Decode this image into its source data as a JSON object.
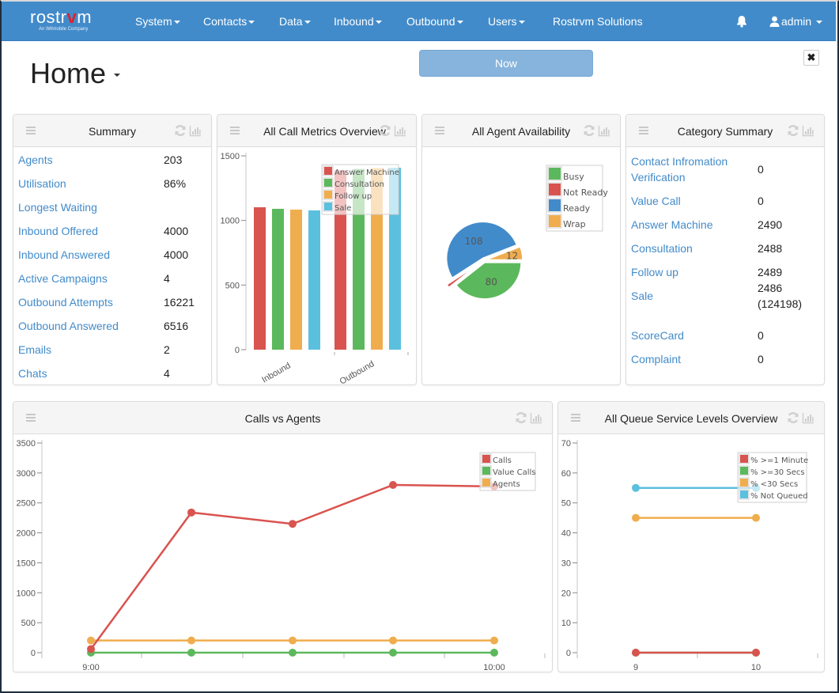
{
  "navbar": {
    "logo": {
      "text_pre": "rostr",
      "text_v": "v",
      "text_post": "m",
      "tagline": "An IMImobile Company"
    },
    "items": [
      {
        "label": "System",
        "dropdown": true
      },
      {
        "label": "Contacts",
        "dropdown": true
      },
      {
        "label": "Data",
        "dropdown": true
      },
      {
        "label": "Inbound",
        "dropdown": true
      },
      {
        "label": "Outbound",
        "dropdown": true
      },
      {
        "label": "Users",
        "dropdown": true
      },
      {
        "label": "Rostrvm Solutions",
        "dropdown": false
      }
    ],
    "notifications_icon": "bell-icon",
    "user": {
      "label": "admin",
      "icon": "user-icon"
    }
  },
  "page": {
    "title": "Home",
    "now_button": "Now",
    "close_button": "✖"
  },
  "panels": {
    "summary": {
      "title": "Summary",
      "rows": [
        {
          "label": "Agents",
          "value": "203"
        },
        {
          "label": "Utilisation",
          "value": "86%"
        },
        {
          "label": "Longest Waiting",
          "value": ""
        },
        {
          "label": "Inbound Offered",
          "value": "4000"
        },
        {
          "label": "Inbound Answered",
          "value": "4000"
        },
        {
          "label": "Active Campaigns",
          "value": "4"
        },
        {
          "label": "Outbound Attempts",
          "value": "16221"
        },
        {
          "label": "Outbound Answered",
          "value": "6516"
        },
        {
          "label": "Emails",
          "value": "2"
        },
        {
          "label": "Chats",
          "value": "4"
        }
      ]
    },
    "call_metrics": {
      "title": "All Call Metrics Overview"
    },
    "agent_availability": {
      "title": "All Agent Availability"
    },
    "category_summary": {
      "title": "Category Summary",
      "rows": [
        {
          "label": "Contact Infromation",
          "label2": "Verification",
          "value": "0"
        },
        {
          "label": "Value Call",
          "value": "0"
        },
        {
          "label": "Answer Machine",
          "value": "2490"
        },
        {
          "label": "Consultation",
          "value": "2488"
        },
        {
          "label": "Follow up",
          "value": "2489"
        },
        {
          "label": "Sale",
          "value": "2486",
          "value2": "(124198)"
        },
        {
          "label": "ScoreCard",
          "value": "0"
        },
        {
          "label": "Complaint",
          "value": "0"
        }
      ]
    },
    "calls_vs_agents": {
      "title": "Calls vs Agents"
    },
    "queue_service": {
      "title": "All Queue Service Levels Overview"
    }
  },
  "colors": {
    "red": "#d9534f",
    "green": "#5cb85c",
    "orange": "#f0ad4e",
    "blue": "#5bc0de",
    "dark_blue": "#428bca",
    "brand": "#428bca"
  },
  "chart_data": [
    {
      "id": "call_metrics",
      "type": "bar",
      "title": "All Call Metrics Overview",
      "categories": [
        "Inbound",
        "Outbound"
      ],
      "series": [
        {
          "name": "Answer Machine",
          "color": "#d9534f",
          "values": [
            1102,
            1388
          ]
        },
        {
          "name": "Consultation",
          "color": "#5cb85c",
          "values": [
            1090,
            1398
          ]
        },
        {
          "name": "Follow up",
          "color": "#f0ad4e",
          "values": [
            1084,
            1405
          ]
        },
        {
          "name": "Sale",
          "color": "#5bc0de",
          "values": [
            1078,
            1408
          ]
        }
      ],
      "ylim": [
        0,
        1500
      ],
      "yticks": [
        0,
        500,
        1000,
        1500
      ],
      "legend": "top-right",
      "xlabel": "",
      "ylabel": ""
    },
    {
      "id": "agent_availability",
      "type": "pie",
      "title": "All Agent Availability",
      "slices": [
        {
          "name": "Busy",
          "color": "#5cb85c",
          "value": 80,
          "label": "80"
        },
        {
          "name": "Not Ready",
          "color": "#d9534f",
          "value": 3,
          "label": ""
        },
        {
          "name": "Ready",
          "color": "#428bca",
          "value": 108,
          "label": "108"
        },
        {
          "name": "Wrap",
          "color": "#f0ad4e",
          "value": 12,
          "label": "12"
        }
      ],
      "legend": "top-right"
    },
    {
      "id": "calls_vs_agents",
      "type": "line",
      "title": "Calls vs Agents",
      "x": [
        "9:00",
        "9:15",
        "9:30",
        "9:45",
        "10:00"
      ],
      "xtick_labels": [
        "9:00",
        "",
        "",
        "",
        "10:00"
      ],
      "series": [
        {
          "name": "Calls",
          "color": "#d9534f",
          "values": [
            60,
            2340,
            2150,
            2800,
            2775
          ]
        },
        {
          "name": "Value Calls",
          "color": "#5cb85c",
          "values": [
            0,
            0,
            0,
            0,
            0
          ]
        },
        {
          "name": "Agents",
          "color": "#f0ad4e",
          "values": [
            203,
            203,
            203,
            203,
            203
          ]
        }
      ],
      "ylim": [
        0,
        3500
      ],
      "yticks": [
        0,
        500,
        1000,
        1500,
        2000,
        2500,
        3000,
        3500
      ],
      "legend": "top-right"
    },
    {
      "id": "queue_service",
      "type": "line",
      "title": "All Queue Service Levels Overview",
      "x": [
        "9",
        "10"
      ],
      "series": [
        {
          "name": "% >=1 Minute",
          "color": "#d9534f",
          "values": [
            0,
            0
          ]
        },
        {
          "name": "% >=30 Secs",
          "color": "#5cb85c",
          "values": [
            0,
            0
          ]
        },
        {
          "name": "% <30 Secs",
          "color": "#f0ad4e",
          "values": [
            45,
            45
          ]
        },
        {
          "name": "% Not Queued",
          "color": "#5bc0de",
          "values": [
            55,
            55
          ]
        }
      ],
      "ylim": [
        0,
        70
      ],
      "yticks": [
        0,
        10,
        20,
        30,
        40,
        50,
        60,
        70
      ],
      "legend": "top-right"
    }
  ]
}
